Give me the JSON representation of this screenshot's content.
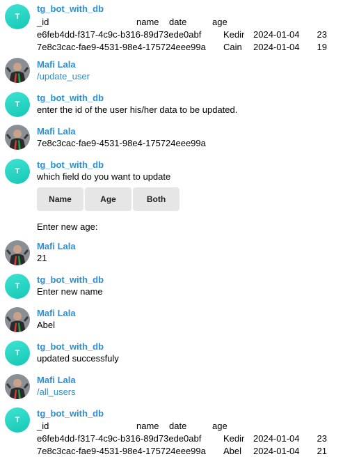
{
  "bot": {
    "name": "tg_bot_with_db",
    "avatar_letter": "T"
  },
  "user": {
    "name": "Mafi Lala"
  },
  "table_header": {
    "id": "_id",
    "name": "name",
    "date": "date",
    "age": "age"
  },
  "first_table": [
    {
      "id": "e6feb4dd-f317-4c9c-b316-89d73ede0abf",
      "name": "Kedir",
      "date": "2024-01-04",
      "age": "23"
    },
    {
      "id": "7e8c3cac-fae9-4531-98e4-175724eee99a",
      "name": "Cain",
      "date": "2024-01-04",
      "age": "19"
    }
  ],
  "messages": {
    "m2": "/update_user",
    "m3": "enter the id of the user his/her data to be updated.",
    "m4": "7e8c3cac-fae9-4531-98e4-175724eee99a",
    "m5": "which field do you want to update",
    "m5b": "Enter new age:",
    "m6": "21",
    "m7": "Enter new name",
    "m8": "Abel",
    "m9": "updated successfuly",
    "m10": "/all_users"
  },
  "keyboard": {
    "name": "Name",
    "age": "Age",
    "both": "Both"
  },
  "last_table": [
    {
      "id": "e6feb4dd-f317-4c9c-b316-89d73ede0abf",
      "name": "Kedir",
      "date": "2024-01-04",
      "age": "23"
    },
    {
      "id": "7e8c3cac-fae9-4531-98e4-175724eee99a",
      "name": "Abel",
      "date": "2024-01-04",
      "age": "21"
    }
  ],
  "colors": {
    "author": "#2b8fd0",
    "bot_avatar": "#1fd0c0",
    "button_bg": "#e6e6e6"
  }
}
